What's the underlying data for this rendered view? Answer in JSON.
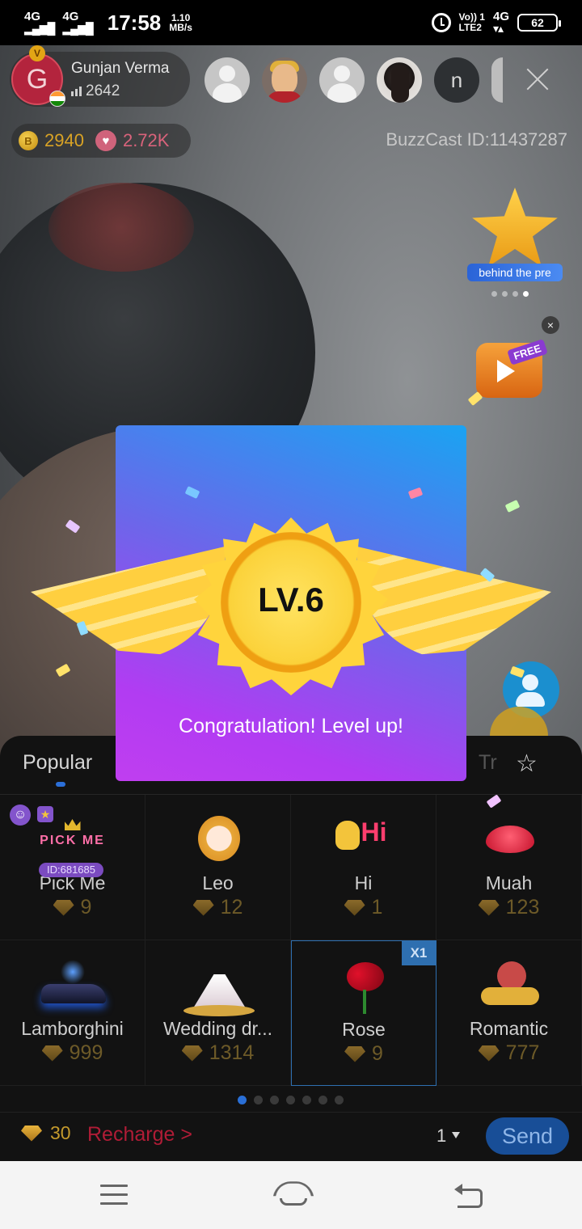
{
  "status_bar": {
    "network1": "4G",
    "network2": "4G",
    "time": "17:58",
    "speed_value": "1.10",
    "speed_unit": "MB/s",
    "volte_line1": "Vo)) 1",
    "volte_line2": "LTE2",
    "network3": "4G",
    "battery": "62"
  },
  "host": {
    "avatar_letter": "G",
    "name": "Gunjan Verma",
    "score": "2642",
    "coins": "2940",
    "likes": "2.72K",
    "id_label": "BuzzCast ID:11437287"
  },
  "viewers": [
    {
      "type": "default-avatar"
    },
    {
      "type": "cartoon-avatar"
    },
    {
      "type": "default-avatar"
    },
    {
      "type": "photo-avatar"
    },
    {
      "type": "letter-avatar",
      "letter": "n"
    }
  ],
  "side_widgets": {
    "star_ribbon_text": "behind the pre",
    "free_label": "FREE",
    "close_label": "×"
  },
  "level_up": {
    "level": "LV.6",
    "message": "Congratulation! Level up!"
  },
  "gift_panel": {
    "tabs": [
      {
        "label": "Popular",
        "active": true
      },
      {
        "label": "Tr",
        "active": false
      }
    ],
    "gifts": [
      {
        "name": "Pick Me",
        "price": "9",
        "tag": "ID:681685",
        "image_text": "PICK ME"
      },
      {
        "name": "Leo",
        "price": "12"
      },
      {
        "name": "Hi",
        "price": "1",
        "image_text": "Hi"
      },
      {
        "name": "Muah",
        "price": "123"
      },
      {
        "name": "Lamborghini",
        "price": "999"
      },
      {
        "name": "Wedding dr...",
        "price": "1314"
      },
      {
        "name": "Rose",
        "price": "9",
        "selected": true,
        "badge": "X1"
      },
      {
        "name": "Romantic",
        "price": "777"
      }
    ],
    "page_count": 7,
    "current_page": 1,
    "balance": "30",
    "recharge_label": "Recharge >",
    "quantity": "1",
    "send_label": "Send"
  },
  "colors": {
    "accent_blue": "#184e97",
    "recharge_red": "#b01c36",
    "coin_gold": "#d9a325",
    "like_pink": "#d9637b"
  }
}
